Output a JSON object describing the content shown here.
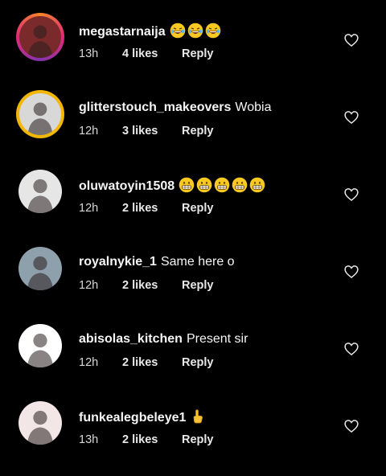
{
  "comments": [
    {
      "username": "megastarnaija",
      "text": "😂😂😂",
      "time": "13h",
      "likes": "4 likes",
      "reply": "Reply",
      "ring": "ig",
      "avatar_bg": "#7a2a2a",
      "emoji": "laugh"
    },
    {
      "username": "glitterstouch_makeovers",
      "text": "Wobia",
      "time": "12h",
      "likes": "3 likes",
      "reply": "Reply",
      "ring": "gold",
      "avatar_bg": "#d8d8d8"
    },
    {
      "username": "oluwatoyin1508",
      "text": "😁😁😁😁😁",
      "time": "12h",
      "likes": "2 likes",
      "reply": "Reply",
      "ring": "none",
      "avatar_bg": "#e6e6e6",
      "emoji": "grin"
    },
    {
      "username": "royalnykie_1",
      "text": "Same here o",
      "time": "12h",
      "likes": "2 likes",
      "reply": "Reply",
      "ring": "none",
      "avatar_bg": "#8fa0ad"
    },
    {
      "username": "abisolas_kitchen",
      "text": "Present sir",
      "time": "12h",
      "likes": "2 likes",
      "reply": "Reply",
      "ring": "none",
      "avatar_bg": "#ffffff"
    },
    {
      "username": "funkealegbeleye1",
      "text": "👆",
      "time": "13h",
      "likes": "2 likes",
      "reply": "Reply",
      "ring": "none",
      "avatar_bg": "#f2e6e6",
      "emoji": "point"
    }
  ],
  "colors": {
    "background": "#000000",
    "text": "#f5f5f5",
    "heart_stroke": "#e6e6e6"
  },
  "icons": {
    "like": "heart-outline-icon"
  }
}
